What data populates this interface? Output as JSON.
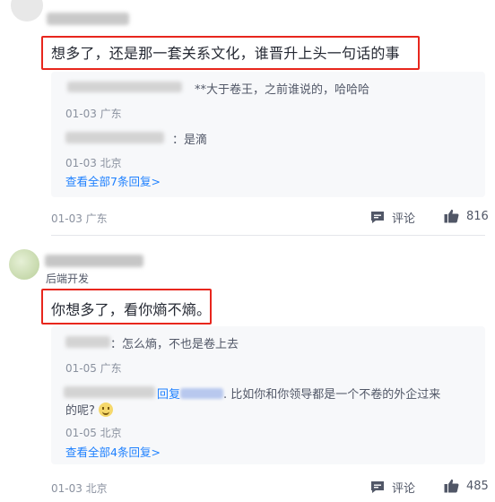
{
  "comments": [
    {
      "text": "想多了，还是那一套关系文化，谁晋升上头一句话的事",
      "replies": [
        {
          "text": "**大于卷王，之前谁说的，哈哈哈",
          "meta": "01-03 广东"
        },
        {
          "text": "：是滴",
          "meta": "01-03 北京"
        }
      ],
      "view_all": "查看全部7条回复>",
      "meta": "01-03 广东",
      "comment_label": "评论",
      "likes": "816"
    },
    {
      "author_title": "后端开发",
      "text": "你想多了，看你熵不熵。",
      "replies": [
        {
          "text": "：怎么熵，不也是卷上去",
          "meta": "01-05 广东"
        },
        {
          "reply_prefix": "回复",
          "text": ". 比如你和你领导都是一个不卷的外企过来",
          "text2": "的呢?",
          "meta": "01-05 北京"
        }
      ],
      "view_all": "查看全部4条回复>",
      "meta": "01-03 北京",
      "comment_label": "评论",
      "likes": "485"
    }
  ],
  "icons": {
    "comment": "comment-bubble-icon",
    "like": "thumbs-up-icon"
  },
  "colors": {
    "highlight_box": "#e8261d",
    "link": "#1e80ff",
    "reply_bg": "#f7f8fa"
  }
}
